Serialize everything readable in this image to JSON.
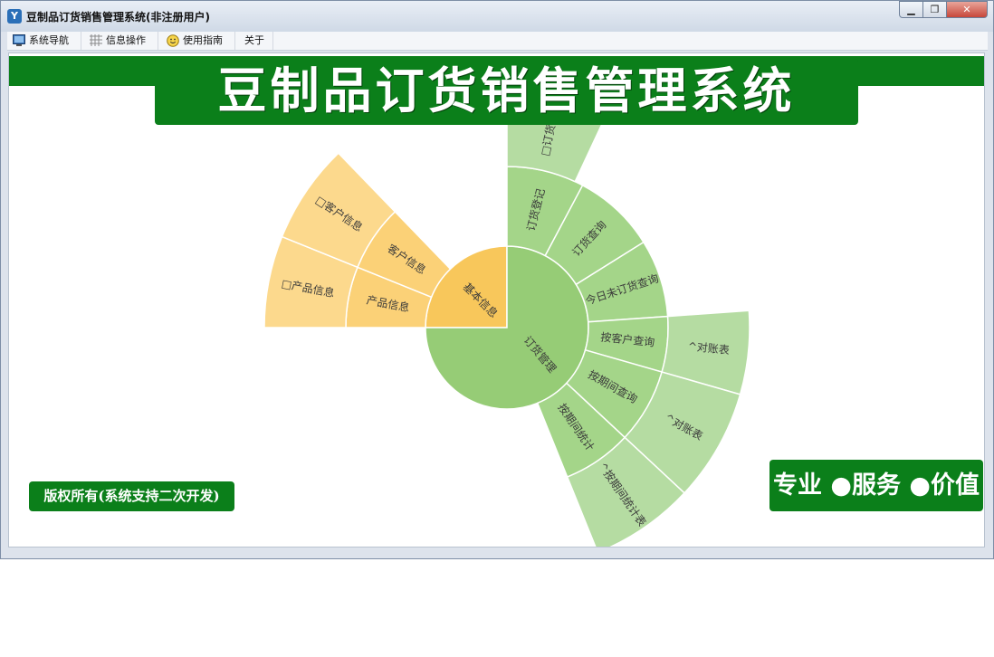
{
  "window": {
    "title": "豆制品订货销售管理系统(非注册用户)",
    "minimize_glyph": "▁",
    "maximize_glyph": "❐",
    "close_glyph": "✕"
  },
  "menu": [
    {
      "label": "系统导航",
      "icon": "monitor-icon"
    },
    {
      "label": "信息操作",
      "icon": "grid-icon"
    },
    {
      "label": "使用指南",
      "icon": "smiley-icon"
    },
    {
      "label": "关于",
      "icon": ""
    }
  ],
  "banner_title": "豆制品订货销售管理系统",
  "copyright": "版权所有(系统支持二次开发)",
  "slogan": "专业 ●服务 ●价值",
  "colors": {
    "brand_green": "#0b7f1a",
    "inner_orange": "#f8c75b",
    "mid_orange": "#fbd177",
    "outer_orange": "#fcd98d",
    "inner_green": "#96cc76",
    "mid_green": "#a4d589",
    "outer_green": "#b5dca2"
  },
  "sunburst": {
    "center_label": "订货管理",
    "basic": {
      "label": "基本信息",
      "children": [
        {
          "label": "客户信息",
          "leaf": "□客户信息"
        },
        {
          "label": "产品信息",
          "leaf": "□产品信息"
        }
      ]
    },
    "order": {
      "children": [
        {
          "label": "订货登记",
          "leaf": "□订货登记"
        },
        {
          "label": "订货查询",
          "leaf": ""
        },
        {
          "label": "今日未订货查询",
          "leaf": ""
        },
        {
          "label": "按客户查询",
          "leaf": "^对账表"
        },
        {
          "label": "按期间查询",
          "leaf": "^对账表"
        },
        {
          "label": "按期间统计",
          "leaf": "^按期间统计表"
        }
      ]
    }
  }
}
